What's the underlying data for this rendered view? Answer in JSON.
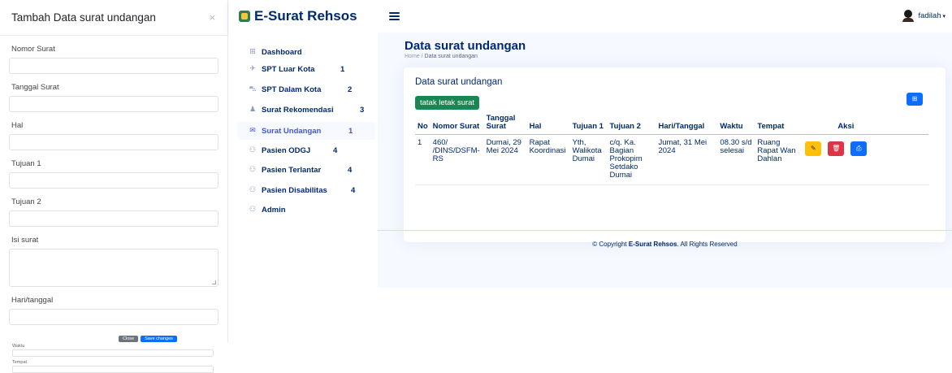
{
  "modal": {
    "title": "Tambah Data surat undangan",
    "close_glyph": "×",
    "fields": {
      "nomor_surat": "Nomor Surat",
      "tanggal_surat": "Tanggal Surat",
      "hal": "Hal",
      "tujuan1": "Tujuan 1",
      "tujuan2": "Tujuan 2",
      "isi_surat": "Isi surat",
      "hari_tanggal": "Hari/tanggal",
      "waktu": "Waktu",
      "tempat": "Tempat"
    },
    "close_label": "Close",
    "save_label": "Save changes"
  },
  "header": {
    "app_name": "E-Surat Rehsos",
    "user_name": "fadilah",
    "caret": "▾"
  },
  "sidebar": {
    "items": [
      {
        "label": "Dashboard",
        "icon": "grid-icon",
        "glyph": "⊞",
        "badge": ""
      },
      {
        "label": "SPT Luar Kota",
        "icon": "airplane-icon",
        "glyph": "✈",
        "badge": "1"
      },
      {
        "label": "SPT Dalam Kota",
        "icon": "car-icon",
        "glyph": "⛍",
        "badge": "2"
      },
      {
        "label": "Surat Rekomendasi",
        "icon": "person-icon",
        "glyph": "♟",
        "badge": "3"
      },
      {
        "label": "Surat Undangan",
        "icon": "envelope-icon",
        "glyph": "✉",
        "badge": "1"
      },
      {
        "label": "Pasien ODGJ",
        "icon": "people-icon",
        "glyph": "⚇",
        "badge": "4"
      },
      {
        "label": "Pasien Terlantar",
        "icon": "people-icon",
        "glyph": "⚇",
        "badge": "4"
      },
      {
        "label": "Pasien Disabilitas",
        "icon": "people-icon",
        "glyph": "⚇",
        "badge": "4"
      },
      {
        "label": "Admin",
        "icon": "people-icon",
        "glyph": "⚇",
        "badge": ""
      }
    ]
  },
  "page": {
    "title": "Data surat undangan",
    "breadcrumb_home": "Home",
    "breadcrumb_sep": "/",
    "breadcrumb_current": "Data surat undangan"
  },
  "card": {
    "title": "Data surat undangan",
    "print_layout_label": "tatak letak surat",
    "add_glyph": "⊞"
  },
  "table": {
    "headers": {
      "no": "No",
      "nomor_surat": "Nomor Surat",
      "tanggal_surat": "Tanggal Surat",
      "hal": "Hal",
      "tujuan1": "Tujuan 1",
      "tujuan2": "Tujuan 2",
      "hari_tanggal": "Hari/Tanggal",
      "waktu": "Waktu",
      "tempat": "Tempat",
      "aksi": "Aksi"
    },
    "rows": [
      {
        "no": "1",
        "nomor_surat": "460/ /DINS/DSFM-RS",
        "tanggal_surat": "Dumai, 29 Mei 2024",
        "hal": "Rapat Koordinasi",
        "tujuan1": "Yth, Walikota Dumai",
        "tujuan2": "c/q. Ka. Bagian Prokopim Setdako Dumai",
        "hari_tanggal": "Jumat, 31 Mei 2024",
        "waktu": "08.30 s/d selesai",
        "tempat": "Ruang Rapat Wan Dahlan"
      }
    ],
    "action_glyphs": {
      "edit": "✎",
      "delete": "🗑",
      "print": "⎙"
    }
  },
  "footer": {
    "prefix": "© Copyright",
    "brand": "E-Surat Rehsos",
    "suffix": ". All Rights Reserved"
  }
}
